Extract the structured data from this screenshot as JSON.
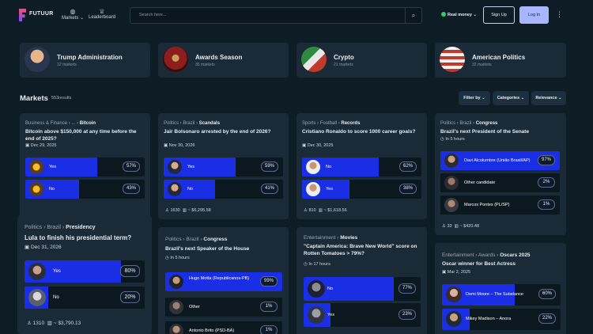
{
  "header": {
    "logo": "FUTUUR",
    "nav": [
      {
        "label": "Markets ⌄",
        "icon": "globe-icon"
      },
      {
        "label": "Leaderboard",
        "icon": "trophy-icon"
      }
    ],
    "search_placeholder": "Search here...",
    "real_money": "Real money",
    "signup": "Sign Up",
    "login": "Log In"
  },
  "categories": [
    {
      "title": "Trump Administration",
      "subtitle": "12 markets"
    },
    {
      "title": "Awards Season",
      "subtitle": "35 markets"
    },
    {
      "title": "Crypto",
      "subtitle": "21 markets"
    },
    {
      "title": "American Politics",
      "subtitle": "32 markets"
    }
  ],
  "markets_section": {
    "title": "Markets",
    "count": "553results",
    "filter_by": "Filter by",
    "categories": "Categories",
    "relevance": "Relevance"
  },
  "markets": [
    {
      "crumb_1": "Business & Finance",
      "crumb_2": "...",
      "crumb_3": "Bitcoin",
      "question": "Bitcoin above $150,000 at any time before the end of 2025?",
      "date": "Dec 29, 2025",
      "options": [
        {
          "label": "Yes",
          "pct": "57%",
          "value": 57
        },
        {
          "label": "No",
          "pct": "43%",
          "value": 43
        }
      ],
      "bettors": "",
      "volume": ""
    },
    {
      "crumb_1": "Politics",
      "crumb_2": "Brazil",
      "crumb_3": "Scandals",
      "question": "Jair Bolsonaro arrested by the end of 2026?",
      "date": "Nov 30, 2026",
      "options": [
        {
          "label": "Yes",
          "pct": "59%",
          "value": 59
        },
        {
          "label": "No",
          "pct": "41%",
          "value": 41
        }
      ],
      "bettors": "1630",
      "volume": "$6,295.58"
    },
    {
      "crumb_1": "Sports",
      "crumb_2": "Football",
      "crumb_3": "Records",
      "question": "Cristiano Ronaldo to score 1000 career goals?",
      "date": "Dec 30, 2025",
      "options": [
        {
          "label": "No",
          "pct": "62%",
          "value": 62
        },
        {
          "label": "Yes",
          "pct": "38%",
          "value": 38
        }
      ],
      "bettors": "810",
      "volume": "$1,618.56"
    },
    {
      "crumb_1": "Politics",
      "crumb_2": "Brazil",
      "crumb_3": "Congress",
      "question": "Brazil's next President of the Senate",
      "date": "In 5 hours",
      "options": [
        {
          "label": "Davi Alcolumbre (União Brasil/AP)",
          "pct": "97%",
          "value": 97
        },
        {
          "label": "Other candidate",
          "pct": "2%",
          "value": 2
        },
        {
          "label": "Marcos Pontes (PL/SP)",
          "pct": "1%",
          "value": 1
        }
      ],
      "bettors": "33",
      "volume": "$420.48"
    },
    {
      "crumb_1": "Politics",
      "crumb_2": "Brazil",
      "crumb_3": "Presidency",
      "question": "Lula to finish his presidential term?",
      "date": "Dec 31, 2026",
      "options": [
        {
          "label": "Yes",
          "pct": "80%",
          "value": 80
        },
        {
          "label": "No",
          "pct": "20%",
          "value": 20
        }
      ],
      "bettors": "1310",
      "volume": "$3,790.13"
    },
    {
      "crumb_1": "Politics",
      "crumb_2": "Brazil",
      "crumb_3": "Congress",
      "question": "Brazil's next Speaker of the House",
      "date": "In 5 hours",
      "options": [
        {
          "label": "Hugo Motta (Republicanos-PB)",
          "pct": "99%",
          "value": 99
        },
        {
          "label": "Other",
          "pct": "1%",
          "value": 1
        },
        {
          "label": "Antonio Brito (PSD-BA)",
          "pct": "1%",
          "value": 1
        }
      ],
      "bettors": "",
      "volume": ""
    },
    {
      "crumb_1": "Entertainment",
      "crumb_2": "",
      "crumb_3": "Movies",
      "question": "\"Captain America: Brave New World\" score on Rotten Tomatoes > 79%?",
      "date": "In 17 hours",
      "options": [
        {
          "label": "No",
          "pct": "77%",
          "value": 77
        },
        {
          "label": "Yes",
          "pct": "23%",
          "value": 23
        }
      ],
      "bettors": "",
      "volume": ""
    },
    {
      "crumb_1": "Entertainment",
      "crumb_2": "Awards",
      "crumb_3": "Oscars 2025",
      "question": "Oscar winner for Best Actress",
      "date": "Mar 2, 2025",
      "options": [
        {
          "label": "Demi Moore – The Substance",
          "pct": "60%",
          "value": 60
        },
        {
          "label": "Mikey Madison – Anora",
          "pct": "22%",
          "value": 22
        }
      ],
      "bettors": "",
      "volume": ""
    }
  ],
  "colors": {
    "bg": "#0e1c26",
    "card": "#1a2a36",
    "bar_fill": "#1a2ee6",
    "accent_login": "#a9b5ff"
  }
}
